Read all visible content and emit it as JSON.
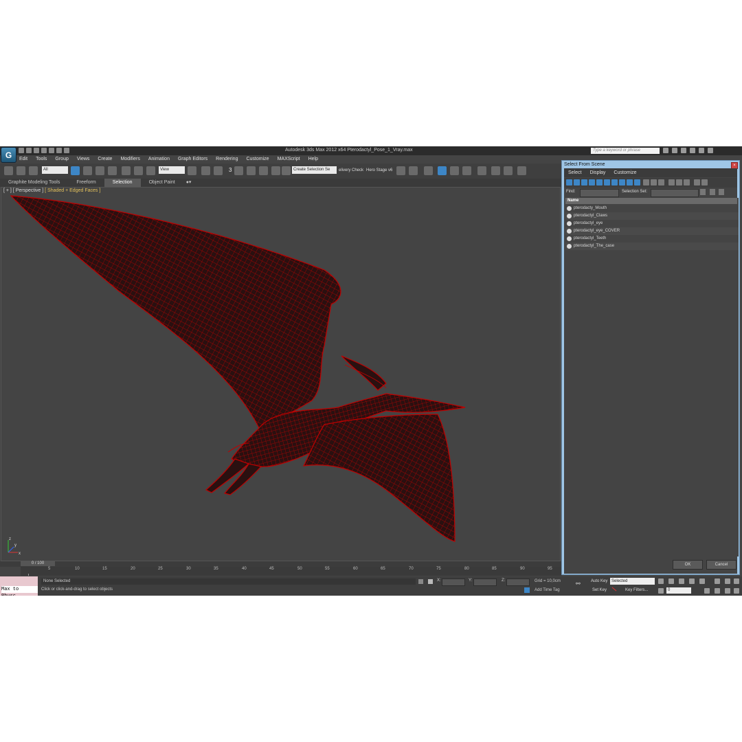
{
  "app": {
    "title": "Autodesk 3ds Max  2012 x64      Pterodactyl_Pose_1_Vray.max",
    "search_placeholder": "Type a keyword or phrase",
    "logo_letter": "G"
  },
  "menu": [
    "Edit",
    "Tools",
    "Group",
    "Views",
    "Create",
    "Modifiers",
    "Animation",
    "Graph Editors",
    "Rendering",
    "Customize",
    "MAXScript",
    "Help"
  ],
  "toolbar": {
    "filter_select": "All",
    "refcoord_select": "View",
    "snaps_label": "3",
    "named_selection": "Create Selection Se",
    "delivery_check": "elivery Check",
    "hero_stage": "Hero Stage v6"
  },
  "ribbon": {
    "tabs": [
      "Graphite Modeling Tools",
      "Freeform",
      "Selection",
      "Object Paint"
    ],
    "active_tab": "Selection"
  },
  "viewport": {
    "label_bracket1": "[ + ]",
    "label_bracket2": "[ Perspective ]",
    "label_bracket3": "[ Shaded + Edged Faces ]",
    "axis_x": "x",
    "axis_y": "y",
    "axis_z": "z"
  },
  "timeline": {
    "frame_display": "0 / 100",
    "ticks": [
      "5",
      "10",
      "15",
      "20",
      "25",
      "30",
      "35",
      "40",
      "45",
      "50",
      "55",
      "60",
      "65",
      "70",
      "75",
      "80",
      "85",
      "90",
      "95"
    ]
  },
  "status": {
    "max_to_physc": "Max to Physc.",
    "selection_status": "None Selected",
    "prompt": "Click or click-and-drag to select objects",
    "x_label": "X:",
    "y_label": "Y:",
    "z_label": "Z:",
    "grid": "Grid = 10,0cm",
    "add_time_tag": "Add Time Tag",
    "auto_key": "Auto Key",
    "set_key": "Set Key",
    "selected_dropdown": "Selected",
    "key_filters": "Key Filters...",
    "frame_field": "0"
  },
  "dialog": {
    "title": "Select From Scene",
    "menu": [
      "Select",
      "Display",
      "Customize"
    ],
    "find_label": "Find:",
    "selection_set_label": "Selection Set:",
    "column_name": "Name",
    "items": [
      "pterodacty_Mouth",
      "pterodactyl_Claws",
      "pterodactyl_eye",
      "pterodactyl_eye_COVER",
      "pterodactyl_Teeth",
      "pterodactyl_The_case"
    ],
    "ok": "OK",
    "cancel": "Cancel"
  },
  "colors": {
    "wireframe": "#c00000",
    "viewport_bg": "#444444",
    "dialog_frame": "#9fc6e6",
    "label_yellow": "#e6c35c"
  }
}
